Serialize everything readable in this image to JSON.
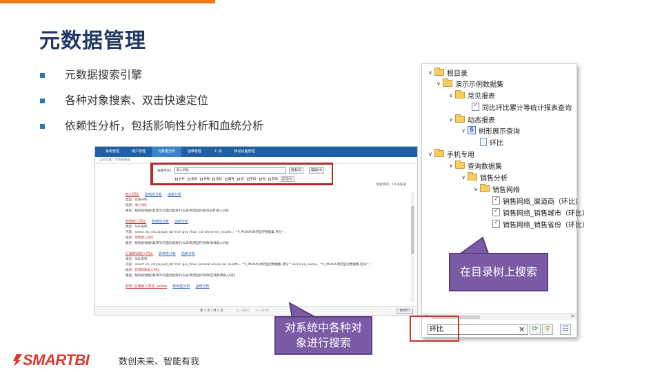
{
  "slide": {
    "title": "元数据管理",
    "bullets": [
      "元数据搜索引擎",
      "各种对象搜索、双击快速定位",
      "依赖性分析，包括影响性分析和血统分析"
    ],
    "accent_color": "#f07a1a",
    "bullet_color": "#2e75b6"
  },
  "web": {
    "nav": [
      "系统管理",
      "用户管理",
      "元数据分析",
      "运维管理",
      "工 具",
      "移动设备管理"
    ],
    "nav_active": "元数据分析",
    "breadcrumb": "当前位置：元数据搜索",
    "search": {
      "label": "关键字(K)：",
      "value": "收入同比",
      "search_button": "搜索(S)",
      "help_button": "帮助(H)",
      "filters": [
        "分析",
        "查询",
        "参数",
        "指标",
        "属性",
        "表",
        "字段",
        "视",
        "其他",
        "反选(R)"
      ]
    },
    "result_info": "搜索到的：14 条纪录",
    "results": [
      {
        "name": "收入同比",
        "links": [
          "影响性分析",
          "血统分析"
        ],
        "lines": [
          {
            "label": "类型：",
            "text": "仪表分析"
          },
          {
            "label": "描述：",
            "text": "收入同比"
          },
          {
            "label": "路径：",
            "text": "根目录\\数据\\集演示\\页面功能演示\\仪表\\政府监控\\税务分析\\收入同比"
          }
        ]
      },
      {
        "name": "财政收入同比",
        "links": [
          "影响性分析",
          "血统分析"
        ],
        "lines": [
          {
            "label": "类型：",
            "text": "SQL查询"
          },
          {
            "label": "内容：",
            "text": "select inc_rat,payout_rat from gov_finan_rat where rec_month= ^P_PARAM.政府监控数据集.月份^ ;"
          },
          {
            "label": "描述：",
            "text": "财政收入同比"
          },
          {
            "label": "路径：",
            "text": "根目录\\数据\\集演示\\页面功能演示\\仪表\\政府监控\\财政\\财政收入同比"
          }
        ]
      },
      {
        "name": "区域财政收入同比",
        "links": [
          "影响性分析",
          "血统分析"
        ],
        "lines": [
          {
            "label": "类型：",
            "text": "SQL查询"
          },
          {
            "label": "内容：",
            "text": "select inc_rat,payout_rat from gov_finan_arearat where rec_month= ^P_PARAM.政府监控数据集.月份^ and area_name= ^P_PARAM.政府监控数据集.区域^ ;"
          },
          {
            "label": "描述：",
            "text": "区域财政收入同比"
          },
          {
            "label": "路径：",
            "text": "根目录\\数据\\集演示\\页面功能演示\\仪表\\政府监控\\财政\\区域财政收入同比"
          }
        ]
      },
      {
        "name": "财政_区域收入同比_action",
        "links": [
          "影响性分析",
          "血统分析"
        ],
        "lines": []
      }
    ],
    "pager": {
      "page": "第 1 页 / 共 1 页",
      "prev": "上一页(P)",
      "next": "下一页(N)",
      "close": "关闭(C)"
    }
  },
  "tree": {
    "items": [
      {
        "label": "根目录",
        "icon": "folder-icon",
        "arrow": "∨"
      },
      {
        "label": "演示示例数据集",
        "icon": "folder-icon",
        "arrow": "∨"
      },
      {
        "label": "常见报表",
        "icon": "folder-icon",
        "arrow": "∨"
      },
      {
        "label": "同比环比累计等统计报表查询",
        "icon": "report-icon",
        "arrow": ""
      },
      {
        "label": "动态报表",
        "icon": "folder-icon",
        "arrow": "∨"
      },
      {
        "label": "树形展示查询",
        "icon": "sql-icon",
        "arrow": "∨"
      },
      {
        "label": "环比",
        "icon": "document-icon",
        "arrow": ""
      },
      {
        "label": "手机专用",
        "icon": "folder-icon",
        "arrow": "∨"
      },
      {
        "label": "查询数据集",
        "icon": "folder-icon",
        "arrow": "∨"
      },
      {
        "label": "销售分析",
        "icon": "folder-icon",
        "arrow": "∨"
      },
      {
        "label": "销售网络",
        "icon": "folder-icon",
        "arrow": "∨"
      },
      {
        "label": "销售网络_渠道商（环比）",
        "icon": "report-icon",
        "arrow": ""
      },
      {
        "label": "销售网络_销售城市（环比）",
        "icon": "report-icon",
        "arrow": ""
      },
      {
        "label": "销售网络_销售省份（环比）",
        "icon": "report-icon",
        "arrow": ""
      }
    ],
    "search_value": "环比",
    "clear_glyph": "✕"
  },
  "callouts": {
    "tree": "在目录树上搜索",
    "system": "对系统中各种对象进行搜索"
  },
  "footer": {
    "logo": "SMARTBI",
    "slogan": "数创未来、智能有我",
    "logo_color": "#d93a2f"
  }
}
